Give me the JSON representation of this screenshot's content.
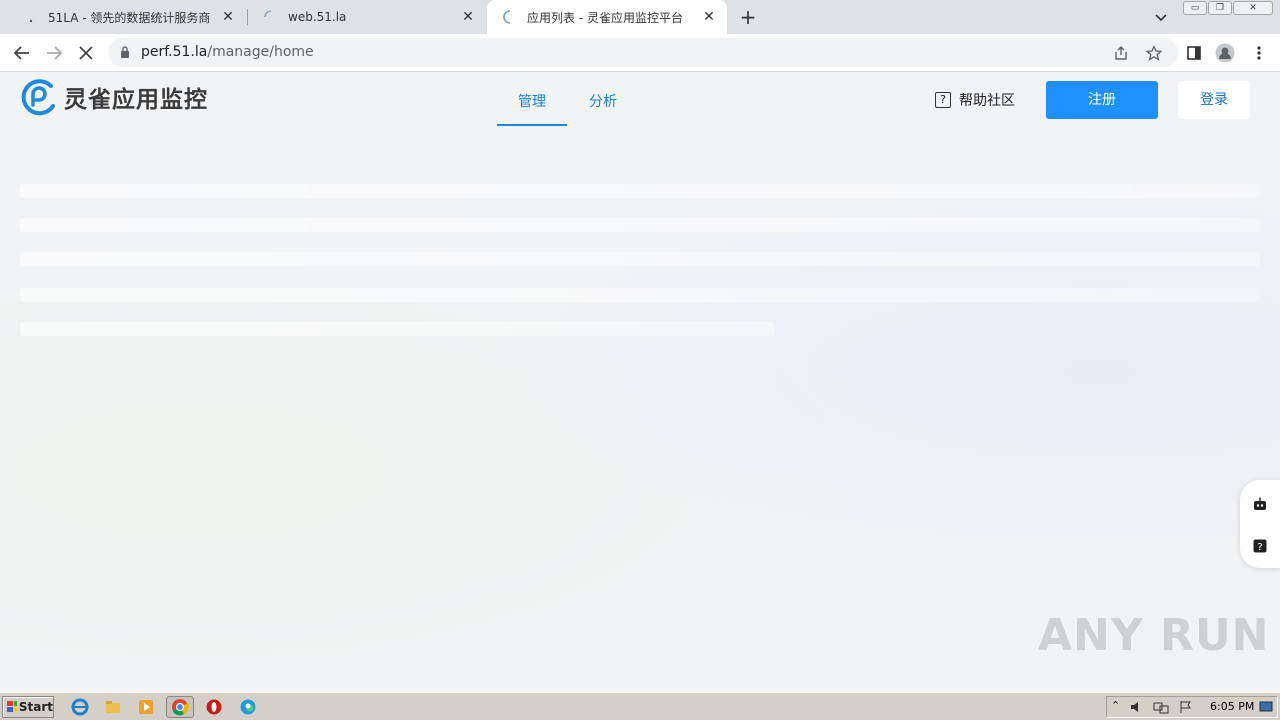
{
  "browser": {
    "tabs": [
      {
        "title": "51LA - 领先的数据统计服务商",
        "active": false
      },
      {
        "title": "web.51.la",
        "active": false
      },
      {
        "title": "应用列表 - 灵雀应用监控平台",
        "active": true
      }
    ],
    "new_tab_label": "+",
    "url_host": "perf.51.la",
    "url_path": "/manage/home"
  },
  "site": {
    "logo_text": "灵雀应用监控",
    "nav": [
      {
        "label": "管理",
        "active": true
      },
      {
        "label": "分析",
        "active": false
      }
    ],
    "help_label": "帮助社区",
    "register_label": "注册",
    "login_label": "登录"
  },
  "watermark": "ANY RUN",
  "taskbar": {
    "start_label": "Start",
    "clock": "6:05 PM"
  },
  "colors": {
    "accent": "#1e90ff",
    "nav_active": "#1a7fd6"
  }
}
